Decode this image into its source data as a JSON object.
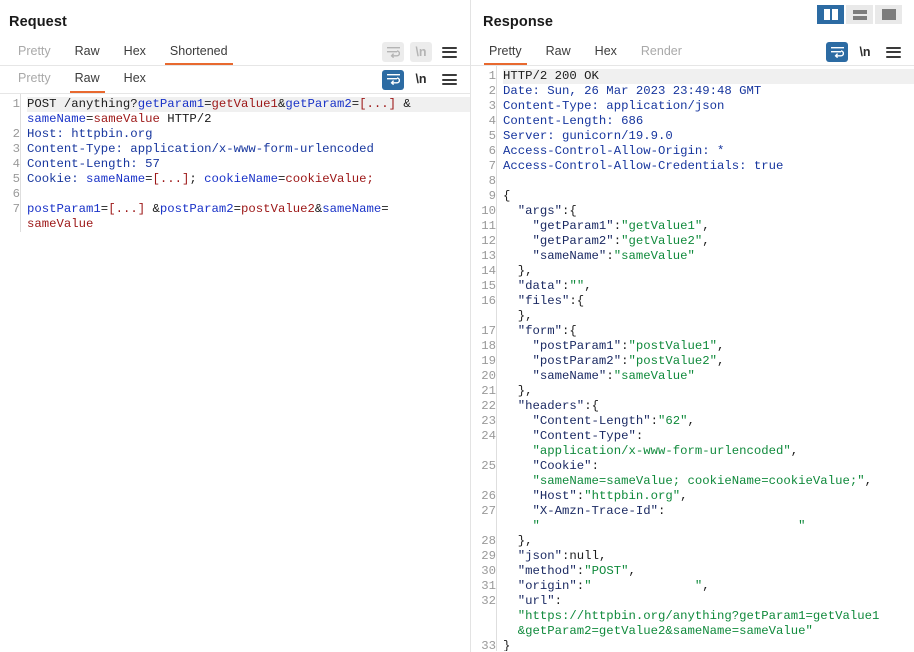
{
  "layout_switch": {
    "buttons": [
      {
        "name": "split-vertical",
        "label": "",
        "active": true
      },
      {
        "name": "split-horizontal",
        "label": "",
        "active": false
      },
      {
        "name": "single-pane",
        "label": "",
        "active": false
      }
    ]
  },
  "request": {
    "title": "Request",
    "tabs_outer": [
      {
        "label": "Pretty",
        "state": "muted"
      },
      {
        "label": "Raw",
        "state": "normal"
      },
      {
        "label": "Hex",
        "state": "normal"
      },
      {
        "label": "Shortened",
        "state": "active"
      }
    ],
    "tabs_inner": [
      {
        "label": "Pretty",
        "state": "muted"
      },
      {
        "label": "Raw",
        "state": "active"
      },
      {
        "label": "Hex",
        "state": "normal"
      }
    ],
    "tools_outer": [
      {
        "name": "word-wrap-icon",
        "state": "disabled"
      },
      {
        "name": "newline-icon",
        "label": "\\n",
        "state": "disabled"
      },
      {
        "name": "menu-icon",
        "state": "normal"
      }
    ],
    "tools_inner": [
      {
        "name": "word-wrap-icon",
        "state": "on"
      },
      {
        "name": "newline-icon",
        "label": "\\n",
        "state": "normal"
      },
      {
        "name": "menu-icon",
        "state": "normal"
      }
    ],
    "line_numbers": [
      "1",
      "",
      "2",
      "3",
      "4",
      "5",
      "6",
      "7",
      ""
    ],
    "lines": [
      [
        {
          "t": "plain",
          "v": "POST /anything?"
        },
        {
          "t": "blue",
          "v": "getParam1"
        },
        {
          "t": "plain",
          "v": "="
        },
        {
          "t": "red",
          "v": "getValue1"
        },
        {
          "t": "plain",
          "v": "&"
        },
        {
          "t": "blue",
          "v": "getParam2"
        },
        {
          "t": "plain",
          "v": "="
        },
        {
          "t": "red",
          "v": "[...]"
        },
        {
          "t": "plain",
          "v": " &"
        }
      ],
      [
        {
          "t": "blue",
          "v": "sameName"
        },
        {
          "t": "plain",
          "v": "="
        },
        {
          "t": "red",
          "v": "sameValue"
        },
        {
          "t": "plain",
          "v": " HTTP/2"
        }
      ],
      [
        {
          "t": "hdr",
          "v": "Host: httpbin.org"
        }
      ],
      [
        {
          "t": "hdr",
          "v": "Content-Type: application/x-www-form-urlencoded"
        }
      ],
      [
        {
          "t": "hdr",
          "v": "Content-Length: 57"
        }
      ],
      [
        {
          "t": "hdr",
          "v": "Cookie: "
        },
        {
          "t": "blue",
          "v": "sameName"
        },
        {
          "t": "plain",
          "v": "="
        },
        {
          "t": "red",
          "v": "[...]"
        },
        {
          "t": "plain",
          "v": "; "
        },
        {
          "t": "blue",
          "v": "cookieName"
        },
        {
          "t": "plain",
          "v": "="
        },
        {
          "t": "red",
          "v": "cookieValue;"
        }
      ],
      [
        {
          "t": "plain",
          "v": ""
        }
      ],
      [
        {
          "t": "blue",
          "v": "postParam1"
        },
        {
          "t": "plain",
          "v": "="
        },
        {
          "t": "red",
          "v": "[...]"
        },
        {
          "t": "plain",
          "v": " &"
        },
        {
          "t": "blue",
          "v": "postParam2"
        },
        {
          "t": "plain",
          "v": "="
        },
        {
          "t": "red",
          "v": "postValue2"
        },
        {
          "t": "plain",
          "v": "&"
        },
        {
          "t": "blue",
          "v": "sameName"
        },
        {
          "t": "plain",
          "v": "="
        }
      ],
      [
        {
          "t": "red",
          "v": "sameValue"
        }
      ]
    ]
  },
  "response": {
    "title": "Response",
    "tabs": [
      {
        "label": "Pretty",
        "state": "active"
      },
      {
        "label": "Raw",
        "state": "normal"
      },
      {
        "label": "Hex",
        "state": "normal"
      },
      {
        "label": "Render",
        "state": "muted"
      }
    ],
    "tools": [
      {
        "name": "word-wrap-icon",
        "state": "on"
      },
      {
        "name": "newline-icon",
        "label": "\\n",
        "state": "normal"
      },
      {
        "name": "menu-icon",
        "state": "normal"
      }
    ],
    "line_numbers": [
      "1",
      "2",
      "3",
      "4",
      "5",
      "6",
      "7",
      "8",
      "9",
      "10",
      "11",
      "12",
      "13",
      "14",
      "15",
      "16",
      "",
      "17",
      "18",
      "19",
      "20",
      "21",
      "22",
      "23",
      "24",
      "",
      "25",
      "",
      "26",
      "27",
      "",
      "28",
      "29",
      "30",
      "31",
      "32",
      "",
      "",
      "33"
    ],
    "lines": [
      [
        {
          "t": "plain",
          "v": "HTTP/2 200 OK"
        }
      ],
      [
        {
          "t": "hdr",
          "v": "Date: Sun, 26 Mar 2023 23:49:48 GMT"
        }
      ],
      [
        {
          "t": "hdr",
          "v": "Content-Type: application/json"
        }
      ],
      [
        {
          "t": "hdr",
          "v": "Content-Length: 686"
        }
      ],
      [
        {
          "t": "hdr",
          "v": "Server: gunicorn/19.9.0"
        }
      ],
      [
        {
          "t": "hdr",
          "v": "Access-Control-Allow-Origin: *"
        }
      ],
      [
        {
          "t": "hdr",
          "v": "Access-Control-Allow-Credentials: true"
        }
      ],
      [
        {
          "t": "plain",
          "v": ""
        }
      ],
      [
        {
          "t": "punct",
          "v": "{"
        }
      ],
      [
        {
          "t": "key",
          "v": "  \"args\""
        },
        {
          "t": "punct",
          "v": ":{"
        }
      ],
      [
        {
          "t": "key",
          "v": "    \"getParam1\""
        },
        {
          "t": "punct",
          "v": ":"
        },
        {
          "t": "str",
          "v": "\"getValue1\""
        },
        {
          "t": "punct",
          "v": ","
        }
      ],
      [
        {
          "t": "key",
          "v": "    \"getParam2\""
        },
        {
          "t": "punct",
          "v": ":"
        },
        {
          "t": "str",
          "v": "\"getValue2\""
        },
        {
          "t": "punct",
          "v": ","
        }
      ],
      [
        {
          "t": "key",
          "v": "    \"sameName\""
        },
        {
          "t": "punct",
          "v": ":"
        },
        {
          "t": "str",
          "v": "\"sameValue\""
        }
      ],
      [
        {
          "t": "punct",
          "v": "  },"
        }
      ],
      [
        {
          "t": "key",
          "v": "  \"data\""
        },
        {
          "t": "punct",
          "v": ":"
        },
        {
          "t": "str",
          "v": "\"\""
        },
        {
          "t": "punct",
          "v": ","
        }
      ],
      [
        {
          "t": "key",
          "v": "  \"files\""
        },
        {
          "t": "punct",
          "v": ":{"
        }
      ],
      [
        {
          "t": "punct",
          "v": "  },"
        }
      ],
      [
        {
          "t": "key",
          "v": "  \"form\""
        },
        {
          "t": "punct",
          "v": ":{"
        }
      ],
      [
        {
          "t": "key",
          "v": "    \"postParam1\""
        },
        {
          "t": "punct",
          "v": ":"
        },
        {
          "t": "str",
          "v": "\"postValue1\""
        },
        {
          "t": "punct",
          "v": ","
        }
      ],
      [
        {
          "t": "key",
          "v": "    \"postParam2\""
        },
        {
          "t": "punct",
          "v": ":"
        },
        {
          "t": "str",
          "v": "\"postValue2\""
        },
        {
          "t": "punct",
          "v": ","
        }
      ],
      [
        {
          "t": "key",
          "v": "    \"sameName\""
        },
        {
          "t": "punct",
          "v": ":"
        },
        {
          "t": "str",
          "v": "\"sameValue\""
        }
      ],
      [
        {
          "t": "punct",
          "v": "  },"
        }
      ],
      [
        {
          "t": "key",
          "v": "  \"headers\""
        },
        {
          "t": "punct",
          "v": ":{"
        }
      ],
      [
        {
          "t": "key",
          "v": "    \"Content-Length\""
        },
        {
          "t": "punct",
          "v": ":"
        },
        {
          "t": "str",
          "v": "\"62\""
        },
        {
          "t": "punct",
          "v": ","
        }
      ],
      [
        {
          "t": "key",
          "v": "    \"Content-Type\""
        },
        {
          "t": "punct",
          "v": ":"
        }
      ],
      [
        {
          "t": "str",
          "v": "    \"application/x-www-form-urlencoded\""
        },
        {
          "t": "punct",
          "v": ","
        }
      ],
      [
        {
          "t": "key",
          "v": "    \"Cookie\""
        },
        {
          "t": "punct",
          "v": ":"
        }
      ],
      [
        {
          "t": "str",
          "v": "    \"sameName=sameValue; cookieName=cookieValue;\""
        },
        {
          "t": "punct",
          "v": ","
        }
      ],
      [
        {
          "t": "key",
          "v": "    \"Host\""
        },
        {
          "t": "punct",
          "v": ":"
        },
        {
          "t": "str",
          "v": "\"httpbin.org\""
        },
        {
          "t": "punct",
          "v": ","
        }
      ],
      [
        {
          "t": "key",
          "v": "    \"X-Amzn-Trace-Id\""
        },
        {
          "t": "punct",
          "v": ":"
        }
      ],
      [
        {
          "t": "str",
          "v": "    \"                                   \""
        }
      ],
      [
        {
          "t": "punct",
          "v": "  },"
        }
      ],
      [
        {
          "t": "key",
          "v": "  \"json\""
        },
        {
          "t": "punct",
          "v": ":null,"
        }
      ],
      [
        {
          "t": "key",
          "v": "  \"method\""
        },
        {
          "t": "punct",
          "v": ":"
        },
        {
          "t": "str",
          "v": "\"POST\""
        },
        {
          "t": "punct",
          "v": ","
        }
      ],
      [
        {
          "t": "key",
          "v": "  \"origin\""
        },
        {
          "t": "punct",
          "v": ":"
        },
        {
          "t": "str",
          "v": "\"              \""
        },
        {
          "t": "punct",
          "v": ","
        }
      ],
      [
        {
          "t": "key",
          "v": "  \"url\""
        },
        {
          "t": "punct",
          "v": ":"
        }
      ],
      [
        {
          "t": "str",
          "v": "  \"https://httpbin.org/anything?getParam1=getValue1"
        }
      ],
      [
        {
          "t": "str",
          "v": "  &getParam2=getValue2&sameName=sameValue\""
        }
      ],
      [
        {
          "t": "punct",
          "v": "}"
        }
      ]
    ]
  }
}
